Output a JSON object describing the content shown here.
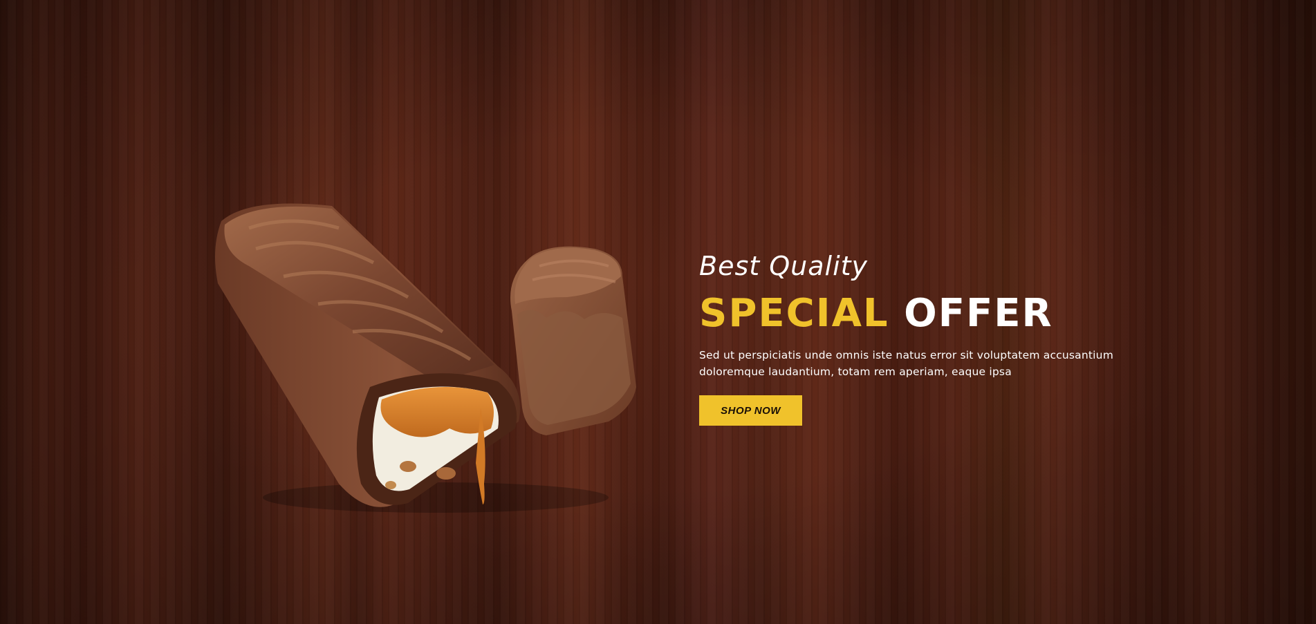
{
  "hero": {
    "tagline": "Best Quality",
    "headline_accent": "SPECIAL",
    "headline_plain": "OFFER",
    "description": "Sed ut perspiciatis unde omnis iste natus error sit voluptatem accusantium doloremque laudantium, totam rem aperiam, eaque ipsa",
    "button_label": "SHOP NOW"
  },
  "colors": {
    "accent": "#f0c22b",
    "background": "#4a1e12",
    "text": "#ffffff"
  },
  "icons": {
    "product_image": "chocolate-caramel-bar"
  }
}
